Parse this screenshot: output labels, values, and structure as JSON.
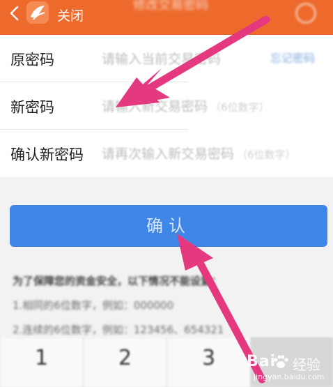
{
  "header": {
    "close_label": "关闭",
    "title": "修改交易密码"
  },
  "form": {
    "rows": [
      {
        "label": "原密码",
        "placeholder": "请输入当前交易密码",
        "extra": "",
        "link": "忘记密码"
      },
      {
        "label": "新密码",
        "placeholder": "请输入新交易密码",
        "extra": "（6位数字）",
        "link": ""
      },
      {
        "label": "确认新密码",
        "placeholder": "请再次输入新交易密码",
        "extra": "（6位数字）",
        "link": ""
      }
    ]
  },
  "confirm_button": {
    "label": "确认"
  },
  "notes": [
    "为了保障您的资金安全，以下情况不能设置：",
    "1.相同的6位数字，例如：000000",
    "2.连续的6位数字，例如：123456、654321"
  ],
  "keypad": {
    "keys": [
      "1",
      "2",
      "3"
    ]
  },
  "watermark": {
    "brand": "Bai",
    "brand_cn": "经验",
    "url": "jingyan.baidu.com"
  },
  "colors": {
    "header_bg": "#ee6a2c",
    "button_bg": "#3f86e6",
    "arrow": "#e5397f"
  }
}
